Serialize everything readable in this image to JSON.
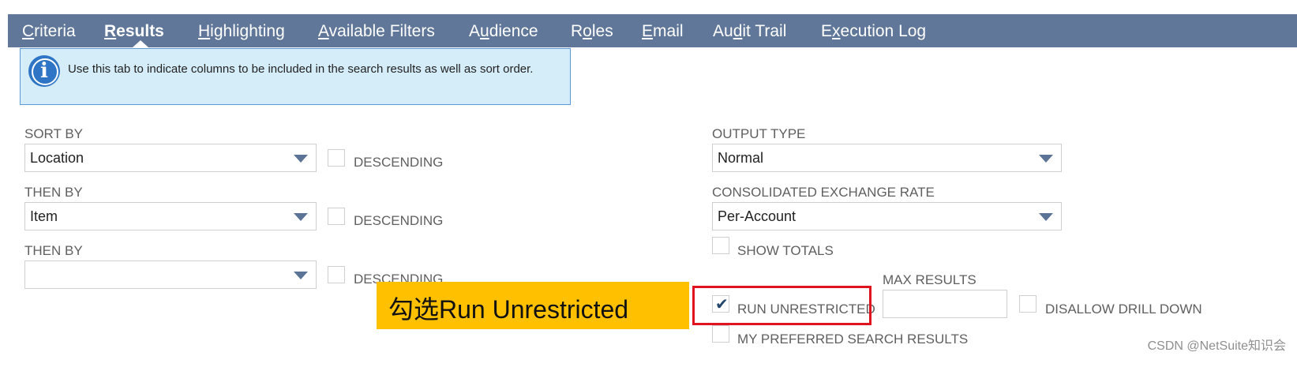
{
  "tabs": [
    {
      "pre": "",
      "key": "C",
      "post": "riteria",
      "active": false
    },
    {
      "pre": "",
      "key": "R",
      "post": "esults",
      "active": true
    },
    {
      "pre": "",
      "key": "H",
      "post": "ighlighting",
      "active": false
    },
    {
      "pre": "",
      "key": "A",
      "post": "vailable Filters",
      "active": false
    },
    {
      "pre": "A",
      "key": "u",
      "post": "dience",
      "active": false
    },
    {
      "pre": "R",
      "key": "o",
      "post": "les",
      "active": false
    },
    {
      "pre": "",
      "key": "E",
      "post": "mail",
      "active": false
    },
    {
      "pre": "Au",
      "key": "d",
      "post": "it Trail",
      "active": false
    },
    {
      "pre": "E",
      "key": "x",
      "post": "ecution Log",
      "active": false
    }
  ],
  "info": {
    "text": "Use this tab to indicate columns to be included in the search results as well as sort order."
  },
  "sort": {
    "sort_by_label": "SORT BY",
    "sort_by_value": "Location",
    "then_by_label": "THEN BY",
    "then_by_value": "Item",
    "then_by2_label": "THEN BY",
    "then_by2_value": "",
    "descending_label": "DESCENDING"
  },
  "output": {
    "output_type_label": "OUTPUT TYPE",
    "output_type_value": "Normal",
    "exchange_rate_label": "CONSOLIDATED EXCHANGE RATE",
    "exchange_rate_value": "Per-Account",
    "show_totals_label": "SHOW TOTALS",
    "max_results_label": "MAX RESULTS",
    "max_results_value": "",
    "run_unrestricted_label": "RUN UNRESTRICTED",
    "run_unrestricted_checked": true,
    "disallow_drill_label": "DISALLOW DRILL DOWN",
    "preferred_label": "MY PREFERRED SEARCH RESULTS"
  },
  "annotation": {
    "text": "勾选Run Unrestricted"
  },
  "watermark": "CSDN @NetSuite知识会",
  "colors": {
    "tabbar": "#607799",
    "info_bg": "#d5edf8",
    "annotation": "#ffc000",
    "highlight_frame": "#e0141e"
  }
}
